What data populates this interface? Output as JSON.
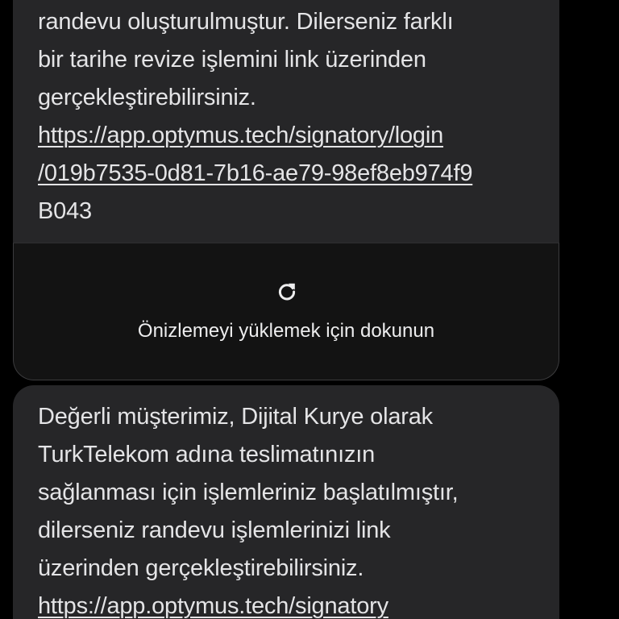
{
  "messages": [
    {
      "lines": [
        "randevu oluşturulmuştur. Dilerseniz farklı",
        "bir tarihe revize işlemini link üzerinden",
        "gerçekleştirebilirsiniz."
      ],
      "link_lines": [
        "https://app.optymus.tech/signatory/login",
        "/019b7535-0d81-7b16-ae79-98ef8eb974f9"
      ],
      "trailing": "B043"
    },
    {
      "lines": [
        "Değerli müşterimiz, Dijital Kurye olarak",
        "TurkTelekom adına teslimatınızın",
        "sağlanması için işlemleriniz başlatılmıştır,",
        "dilerseniz randevu işlemlerinizi link",
        "üzerinden gerçekleştirebilirsiniz."
      ],
      "link_lines": [
        "https://app.optymus.tech/signatory"
      ]
    }
  ],
  "preview": {
    "icon": "refresh-icon",
    "label": "Önizlemeyi yüklemek için dokunun"
  },
  "colors": {
    "background": "#000000",
    "bubble": "#262628",
    "preview_card": "#131313",
    "text": "#e4e4e6"
  }
}
